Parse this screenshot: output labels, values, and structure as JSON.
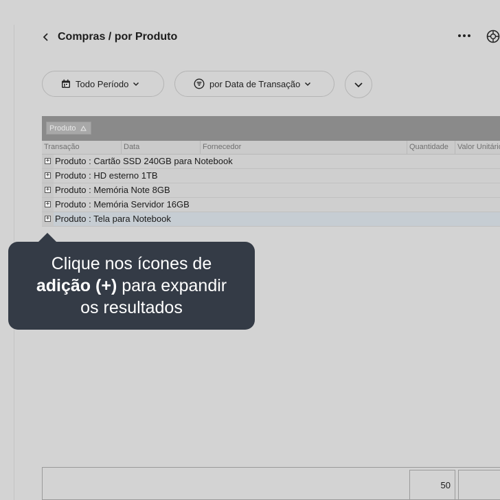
{
  "header": {
    "title": "Compras / por Produto"
  },
  "filters": {
    "period_label": "Todo Período",
    "order_label": "por Data de Transação"
  },
  "grid": {
    "group_chip_label": "Produto",
    "columns": [
      "Transação",
      "Data",
      "Fornecedor",
      "Quantidade",
      "Valor Unitário"
    ],
    "rows": [
      "Produto : Cartão SSD 240GB para Notebook",
      "Produto : HD esterno 1TB",
      "Produto : Memória Note 8GB",
      "Produto : Memória Servidor 16GB",
      "Produto : Tela para Notebook"
    ],
    "selected_row": 4
  },
  "tooltip": {
    "line1": "Clique nos ícones de",
    "line2_bold": "adição (+)",
    "line2_rest": " para expandir",
    "line3": "os resultados"
  },
  "footer": {
    "quantity_total": "50"
  },
  "icons": {
    "back": "chevron-left-icon",
    "more": "more-horizontal-icon",
    "globe": "globe-icon",
    "calendar": "calendar-icon",
    "filter": "filter-icon",
    "expand": "chevron-down-icon",
    "sort": "sort-triangle-icon"
  },
  "colors": {
    "tooltip_bg": "#343b46",
    "group_bar": "#8a8a8a",
    "background": "#d3d3d3"
  }
}
